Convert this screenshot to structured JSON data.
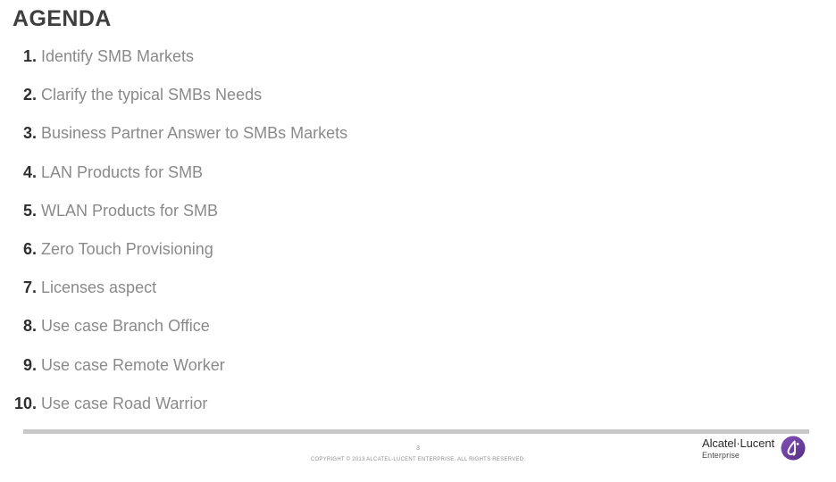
{
  "slide": {
    "title": "AGENDA",
    "items": [
      {
        "number": "1.",
        "label": "Identify SMB Markets"
      },
      {
        "number": "2.",
        "label": "Clarify the typical SMBs Needs"
      },
      {
        "number": "3.",
        "label": "Business Partner Answer to SMBs Markets"
      },
      {
        "number": "4.",
        "label": "LAN Products for SMB"
      },
      {
        "number": "5.",
        "label": "WLAN Products for SMB"
      },
      {
        "number": "6.",
        "label": "Zero Touch Provisioning"
      },
      {
        "number": "7.",
        "label": "Licenses aspect"
      },
      {
        "number": "8.",
        "label": "Use case Branch Office"
      },
      {
        "number": "9.",
        "label": "Use case Remote Worker"
      },
      {
        "number": "10.",
        "label": "Use case Road Warrior"
      }
    ]
  },
  "footer": {
    "page_number": "3",
    "copyright": "COPYRIGHT © 2013 ALCATEL-LUCENT ENTERPRISE.  ALL RIGHTS RESERVED."
  },
  "logo": {
    "wordmark": "Alcatel·Lucent",
    "sub": "Enterprise",
    "badge_icon": "alcatel-lucent-badge-icon",
    "badge_color": "#6c3f9e",
    "badge_glyph_color": "#ffffff"
  },
  "colors": {
    "title": "#3f3f3f",
    "number": "#2e2e2e",
    "item_text": "#8a8a8a",
    "rule": "#c8c8c8",
    "footer_text": "#8e8e8e",
    "background": "#ffffff"
  }
}
